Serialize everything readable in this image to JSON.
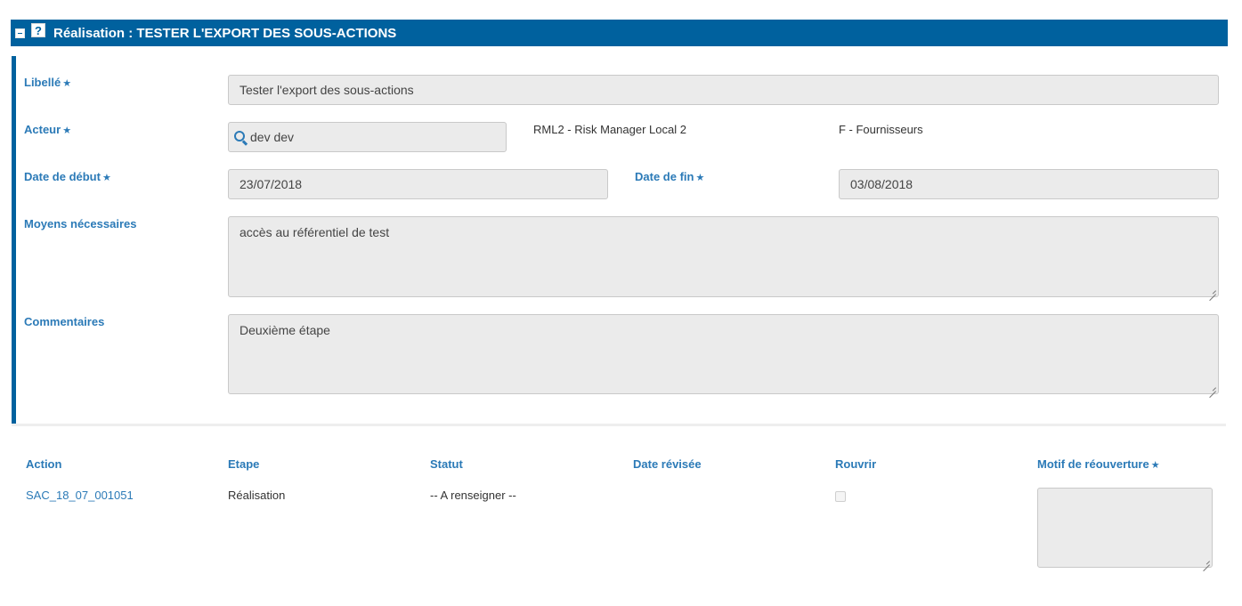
{
  "header": {
    "title": "Réalisation : TESTER L'EXPORT DES SOUS-ACTIONS",
    "collapse_icon": "minus-square-icon",
    "help_icon_glyph": "?"
  },
  "form": {
    "libelle": {
      "label": "Libellé",
      "value": "Tester l'export des sous-actions",
      "required": true
    },
    "acteur": {
      "label": "Acteur",
      "value": "dev dev",
      "role": "RML2 - Risk Manager Local 2",
      "group": "F - Fournisseurs",
      "required": true,
      "icon": "search-icon"
    },
    "date_debut": {
      "label": "Date de début",
      "value": "23/07/2018",
      "required": true
    },
    "date_fin": {
      "label": "Date de fin",
      "value": "03/08/2018",
      "required": true
    },
    "moyens": {
      "label": "Moyens nécessaires",
      "value": "accès au référentiel de test"
    },
    "commentaires": {
      "label": "Commentaires",
      "value": "Deuxième étape"
    }
  },
  "required_star": "★",
  "table": {
    "headers": {
      "action": "Action",
      "etape": "Etape",
      "statut": "Statut",
      "date_revisee": "Date révisée",
      "rouvrir": "Rouvrir",
      "motif": "Motif de réouverture"
    },
    "row": {
      "action": "SAC_18_07_001051",
      "etape": "Réalisation",
      "statut": "-- A renseigner --",
      "date_revisee": "",
      "rouvrir": false,
      "motif": ""
    }
  },
  "colors": {
    "brand": "#00619e",
    "label": "#2b7ab7",
    "field_bg": "#ebebeb"
  }
}
